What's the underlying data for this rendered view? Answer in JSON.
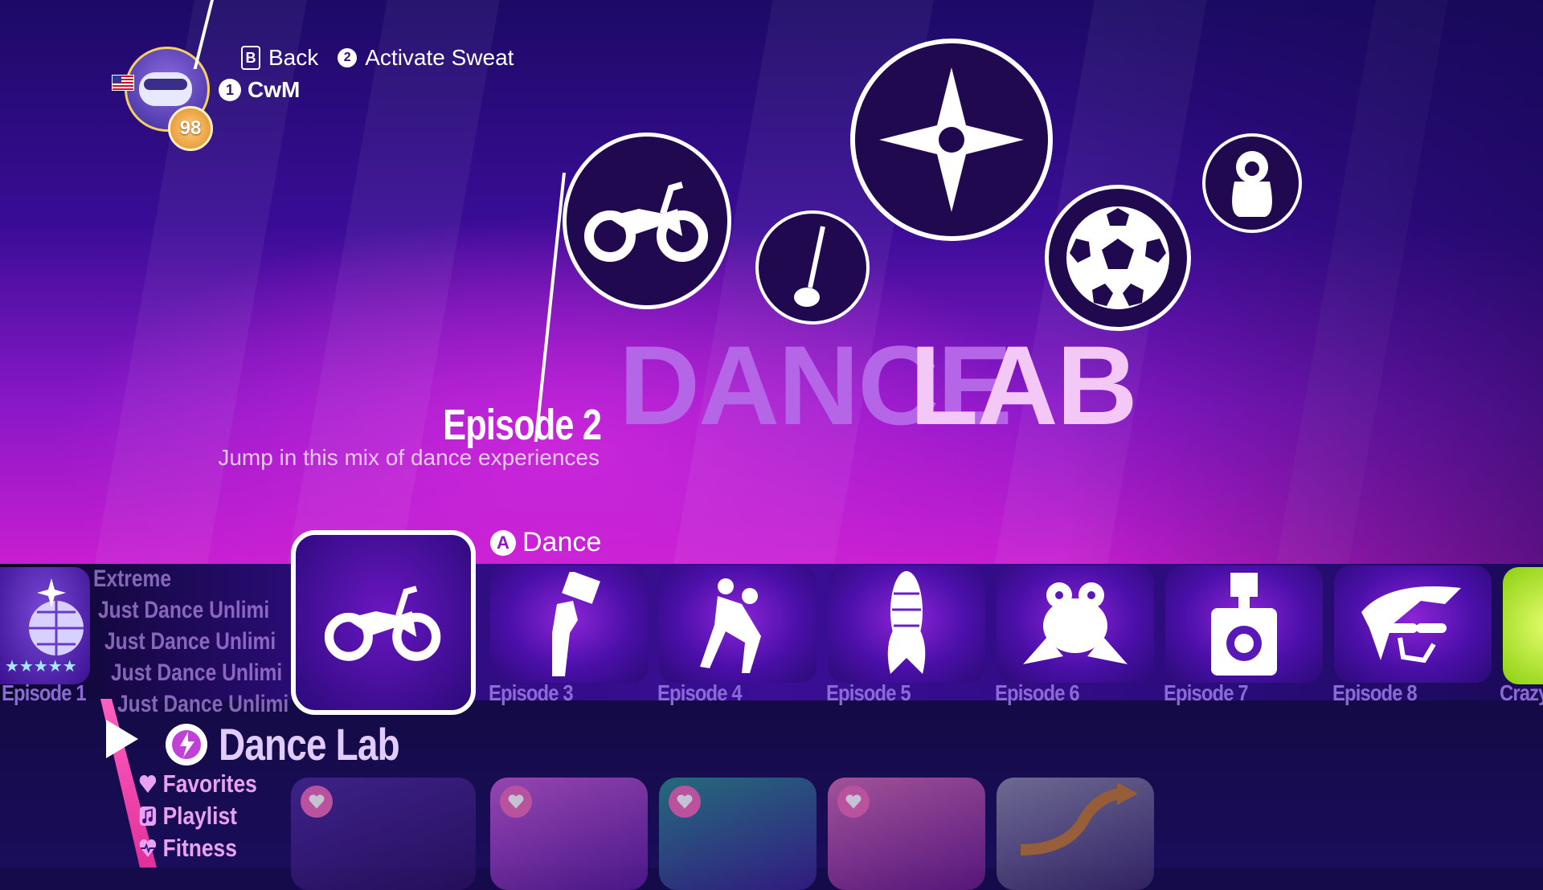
{
  "hints": {
    "back_key": "B",
    "back_label": "Back",
    "sweat_key": "2",
    "sweat_label": "Activate Sweat"
  },
  "profile": {
    "player_number": "1",
    "player_name": "CwM",
    "level": "98"
  },
  "playlist": {
    "title_part1": "DANCE",
    "title_part2": "LAB",
    "episode": "Episode 2",
    "tagline": "Jump in this mix of dance experiences"
  },
  "emblems": [
    "motorcycle-icon",
    "sitar-icon",
    "shuriken-icon",
    "soccer-ball-icon",
    "matryoshka-icon"
  ],
  "action": {
    "key": "A",
    "label": "Dance"
  },
  "episodes": [
    {
      "label": "Episode 1",
      "icon": "disco-ball-icon"
    },
    {
      "label": "Episode 3",
      "icon": "hand-card-icon"
    },
    {
      "label": "Episode 4",
      "icon": "dancing-couple-icon"
    },
    {
      "label": "Episode 5",
      "icon": "corn-icon"
    },
    {
      "label": "Episode 6",
      "icon": "frog-icon"
    },
    {
      "label": "Episode 7",
      "icon": "camera-icon"
    },
    {
      "label": "Episode 8",
      "icon": "sunglasses-face-icon"
    },
    {
      "label": "Crazy",
      "icon": "tennis-ball-icon"
    }
  ],
  "menu_above": [
    "Extreme",
    "Just Dance Unlimi",
    "Just Dance Unlimi",
    "Just Dance Unlimi",
    "Just Dance Unlimi"
  ],
  "category": {
    "label": "Dance Lab"
  },
  "submenu": [
    "Favorites",
    "Playlist",
    "Fitness"
  ],
  "colors": {
    "accent_pink": "#e0309a",
    "title_purple": "#b566e6",
    "title_light": "#f3c8f6"
  }
}
